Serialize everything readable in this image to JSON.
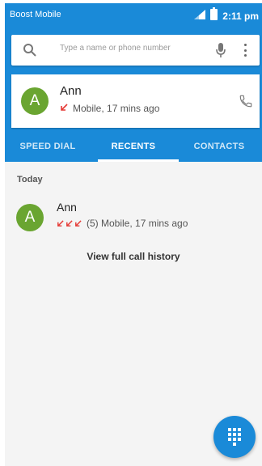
{
  "status_bar": {
    "carrier": "Boost Mobile",
    "time": "2:11 pm",
    "icons": [
      "signal-icon",
      "battery-icon"
    ]
  },
  "search": {
    "placeholder": "Type a name or phone number",
    "icons": [
      "search-icon",
      "mic-icon",
      "more-vert-icon"
    ]
  },
  "contact_card": {
    "avatar_letter": "A",
    "avatar_color": "#6aa531",
    "name": "Ann",
    "detail": "Mobile, 17 mins ago",
    "call_icon": "phone-icon"
  },
  "tabs": [
    {
      "label": "SPEED DIAL",
      "active": false
    },
    {
      "label": "RECENTS",
      "active": true
    },
    {
      "label": "CONTACTS",
      "active": false
    }
  ],
  "recents": {
    "section_label": "Today",
    "items": [
      {
        "avatar_letter": "A",
        "name": "Ann",
        "detail": "(5) Mobile, 17 mins ago"
      }
    ],
    "full_history_label": "View full call history"
  },
  "colors": {
    "accent": "#1a8ad8",
    "missed_call": "#e53935",
    "avatar": "#6aa531"
  },
  "fab": {
    "icon": "dialpad-icon"
  }
}
